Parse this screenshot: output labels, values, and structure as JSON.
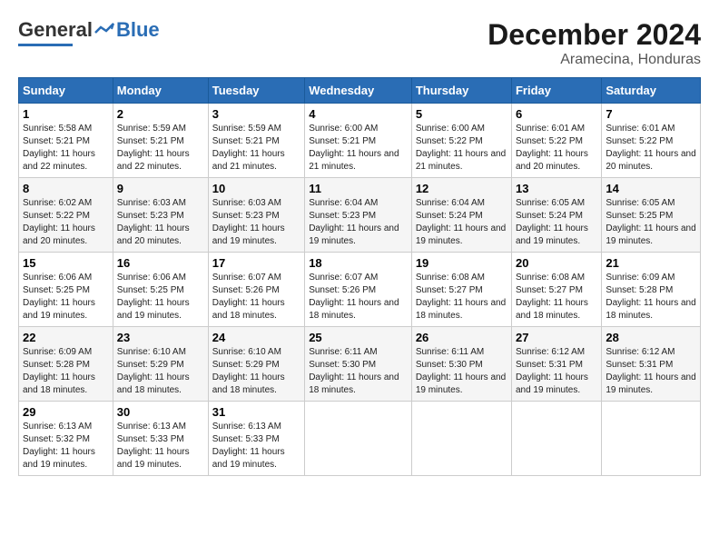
{
  "logo": {
    "general": "General",
    "blue": "Blue"
  },
  "title": "December 2024",
  "subtitle": "Aramecina, Honduras",
  "days_header": [
    "Sunday",
    "Monday",
    "Tuesday",
    "Wednesday",
    "Thursday",
    "Friday",
    "Saturday"
  ],
  "weeks": [
    [
      {
        "day": "1",
        "sunrise": "Sunrise: 5:58 AM",
        "sunset": "Sunset: 5:21 PM",
        "daylight": "Daylight: 11 hours and 22 minutes."
      },
      {
        "day": "2",
        "sunrise": "Sunrise: 5:59 AM",
        "sunset": "Sunset: 5:21 PM",
        "daylight": "Daylight: 11 hours and 22 minutes."
      },
      {
        "day": "3",
        "sunrise": "Sunrise: 5:59 AM",
        "sunset": "Sunset: 5:21 PM",
        "daylight": "Daylight: 11 hours and 21 minutes."
      },
      {
        "day": "4",
        "sunrise": "Sunrise: 6:00 AM",
        "sunset": "Sunset: 5:21 PM",
        "daylight": "Daylight: 11 hours and 21 minutes."
      },
      {
        "day": "5",
        "sunrise": "Sunrise: 6:00 AM",
        "sunset": "Sunset: 5:22 PM",
        "daylight": "Daylight: 11 hours and 21 minutes."
      },
      {
        "day": "6",
        "sunrise": "Sunrise: 6:01 AM",
        "sunset": "Sunset: 5:22 PM",
        "daylight": "Daylight: 11 hours and 20 minutes."
      },
      {
        "day": "7",
        "sunrise": "Sunrise: 6:01 AM",
        "sunset": "Sunset: 5:22 PM",
        "daylight": "Daylight: 11 hours and 20 minutes."
      }
    ],
    [
      {
        "day": "8",
        "sunrise": "Sunrise: 6:02 AM",
        "sunset": "Sunset: 5:22 PM",
        "daylight": "Daylight: 11 hours and 20 minutes."
      },
      {
        "day": "9",
        "sunrise": "Sunrise: 6:03 AM",
        "sunset": "Sunset: 5:23 PM",
        "daylight": "Daylight: 11 hours and 20 minutes."
      },
      {
        "day": "10",
        "sunrise": "Sunrise: 6:03 AM",
        "sunset": "Sunset: 5:23 PM",
        "daylight": "Daylight: 11 hours and 19 minutes."
      },
      {
        "day": "11",
        "sunrise": "Sunrise: 6:04 AM",
        "sunset": "Sunset: 5:23 PM",
        "daylight": "Daylight: 11 hours and 19 minutes."
      },
      {
        "day": "12",
        "sunrise": "Sunrise: 6:04 AM",
        "sunset": "Sunset: 5:24 PM",
        "daylight": "Daylight: 11 hours and 19 minutes."
      },
      {
        "day": "13",
        "sunrise": "Sunrise: 6:05 AM",
        "sunset": "Sunset: 5:24 PM",
        "daylight": "Daylight: 11 hours and 19 minutes."
      },
      {
        "day": "14",
        "sunrise": "Sunrise: 6:05 AM",
        "sunset": "Sunset: 5:25 PM",
        "daylight": "Daylight: 11 hours and 19 minutes."
      }
    ],
    [
      {
        "day": "15",
        "sunrise": "Sunrise: 6:06 AM",
        "sunset": "Sunset: 5:25 PM",
        "daylight": "Daylight: 11 hours and 19 minutes."
      },
      {
        "day": "16",
        "sunrise": "Sunrise: 6:06 AM",
        "sunset": "Sunset: 5:25 PM",
        "daylight": "Daylight: 11 hours and 19 minutes."
      },
      {
        "day": "17",
        "sunrise": "Sunrise: 6:07 AM",
        "sunset": "Sunset: 5:26 PM",
        "daylight": "Daylight: 11 hours and 18 minutes."
      },
      {
        "day": "18",
        "sunrise": "Sunrise: 6:07 AM",
        "sunset": "Sunset: 5:26 PM",
        "daylight": "Daylight: 11 hours and 18 minutes."
      },
      {
        "day": "19",
        "sunrise": "Sunrise: 6:08 AM",
        "sunset": "Sunset: 5:27 PM",
        "daylight": "Daylight: 11 hours and 18 minutes."
      },
      {
        "day": "20",
        "sunrise": "Sunrise: 6:08 AM",
        "sunset": "Sunset: 5:27 PM",
        "daylight": "Daylight: 11 hours and 18 minutes."
      },
      {
        "day": "21",
        "sunrise": "Sunrise: 6:09 AM",
        "sunset": "Sunset: 5:28 PM",
        "daylight": "Daylight: 11 hours and 18 minutes."
      }
    ],
    [
      {
        "day": "22",
        "sunrise": "Sunrise: 6:09 AM",
        "sunset": "Sunset: 5:28 PM",
        "daylight": "Daylight: 11 hours and 18 minutes."
      },
      {
        "day": "23",
        "sunrise": "Sunrise: 6:10 AM",
        "sunset": "Sunset: 5:29 PM",
        "daylight": "Daylight: 11 hours and 18 minutes."
      },
      {
        "day": "24",
        "sunrise": "Sunrise: 6:10 AM",
        "sunset": "Sunset: 5:29 PM",
        "daylight": "Daylight: 11 hours and 18 minutes."
      },
      {
        "day": "25",
        "sunrise": "Sunrise: 6:11 AM",
        "sunset": "Sunset: 5:30 PM",
        "daylight": "Daylight: 11 hours and 18 minutes."
      },
      {
        "day": "26",
        "sunrise": "Sunrise: 6:11 AM",
        "sunset": "Sunset: 5:30 PM",
        "daylight": "Daylight: 11 hours and 19 minutes."
      },
      {
        "day": "27",
        "sunrise": "Sunrise: 6:12 AM",
        "sunset": "Sunset: 5:31 PM",
        "daylight": "Daylight: 11 hours and 19 minutes."
      },
      {
        "day": "28",
        "sunrise": "Sunrise: 6:12 AM",
        "sunset": "Sunset: 5:31 PM",
        "daylight": "Daylight: 11 hours and 19 minutes."
      }
    ],
    [
      {
        "day": "29",
        "sunrise": "Sunrise: 6:13 AM",
        "sunset": "Sunset: 5:32 PM",
        "daylight": "Daylight: 11 hours and 19 minutes."
      },
      {
        "day": "30",
        "sunrise": "Sunrise: 6:13 AM",
        "sunset": "Sunset: 5:33 PM",
        "daylight": "Daylight: 11 hours and 19 minutes."
      },
      {
        "day": "31",
        "sunrise": "Sunrise: 6:13 AM",
        "sunset": "Sunset: 5:33 PM",
        "daylight": "Daylight: 11 hours and 19 minutes."
      },
      null,
      null,
      null,
      null
    ]
  ]
}
